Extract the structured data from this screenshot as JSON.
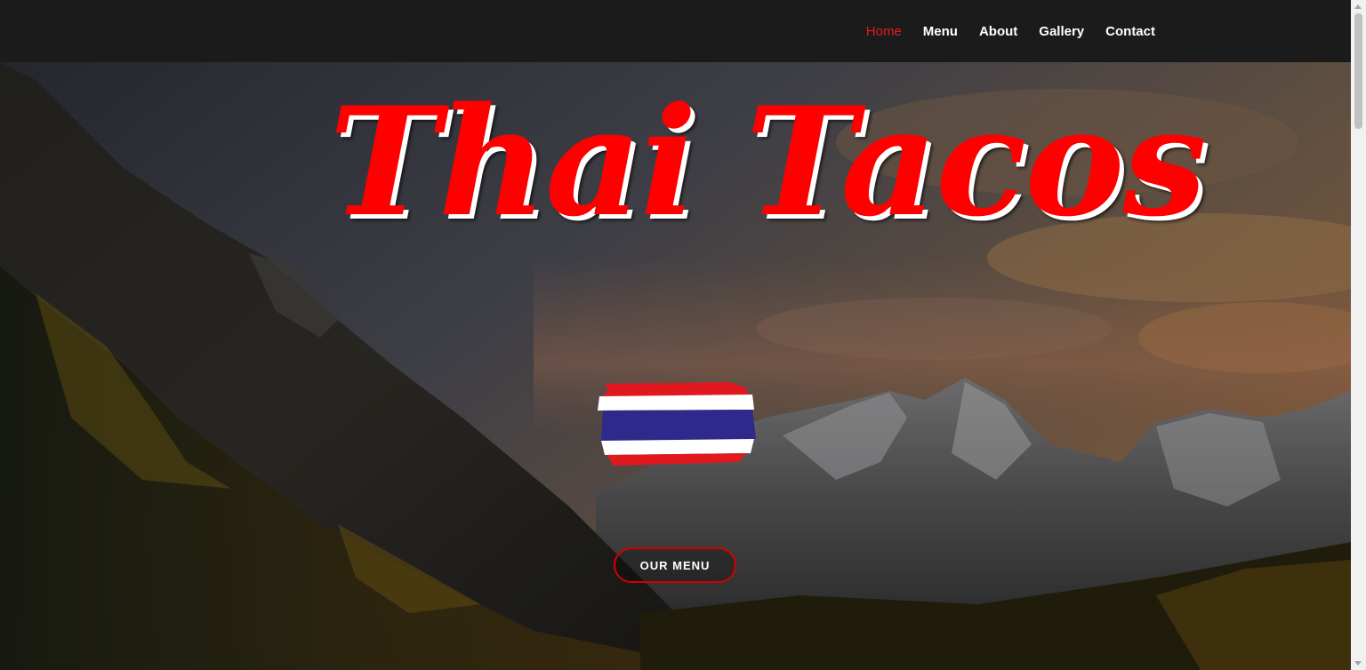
{
  "nav": {
    "items": [
      {
        "label": "Home",
        "active": true
      },
      {
        "label": "Menu",
        "active": false
      },
      {
        "label": "About",
        "active": false
      },
      {
        "label": "Gallery",
        "active": false
      },
      {
        "label": "Contact",
        "active": false
      }
    ]
  },
  "hero": {
    "title": "Thai Tacos",
    "button_label": "OUR MENU",
    "flag_icon": "thailand-flag-icon"
  },
  "colors": {
    "accent": "#ff0000",
    "nav_active": "#e31b1b",
    "navbar_bg": "#1c1b1b",
    "button_border": "#d40000"
  }
}
